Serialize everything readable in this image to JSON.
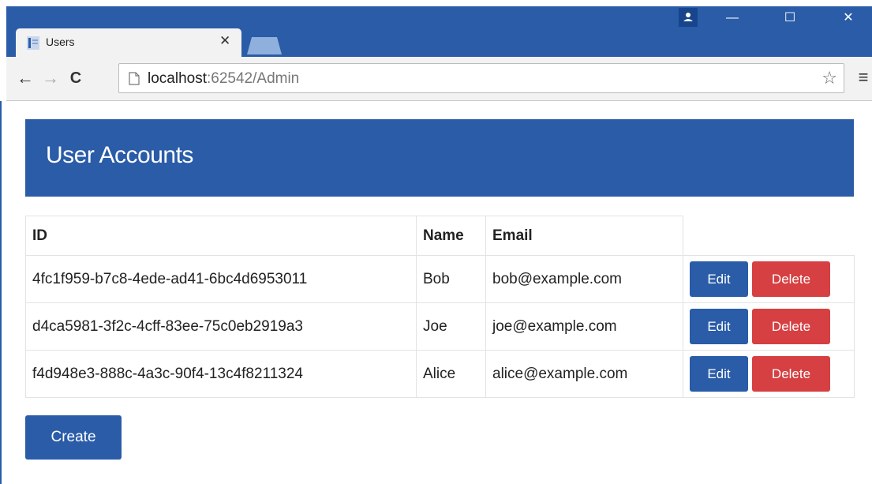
{
  "browser": {
    "tab": {
      "title": "Users"
    },
    "address": {
      "host": "localhost",
      "path": ":62542/Admin"
    }
  },
  "page": {
    "title": "User Accounts",
    "table": {
      "headers": {
        "id": "ID",
        "name": "Name",
        "email": "Email"
      },
      "rows": [
        {
          "id": "4fc1f959-b7c8-4ede-ad41-6bc4d6953011",
          "name": "Bob",
          "email": "bob@example.com",
          "edit": "Edit",
          "delete": "Delete"
        },
        {
          "id": "d4ca5981-3f2c-4cff-83ee-75c0eb2919a3",
          "name": "Joe",
          "email": "joe@example.com",
          "edit": "Edit",
          "delete": "Delete"
        },
        {
          "id": "f4d948e3-888c-4a3c-90f4-13c4f8211324",
          "name": "Alice",
          "email": "alice@example.com",
          "edit": "Edit",
          "delete": "Delete"
        }
      ]
    },
    "create_label": "Create"
  },
  "colors": {
    "primary": "#2a5ca8",
    "danger": "#d64042"
  }
}
